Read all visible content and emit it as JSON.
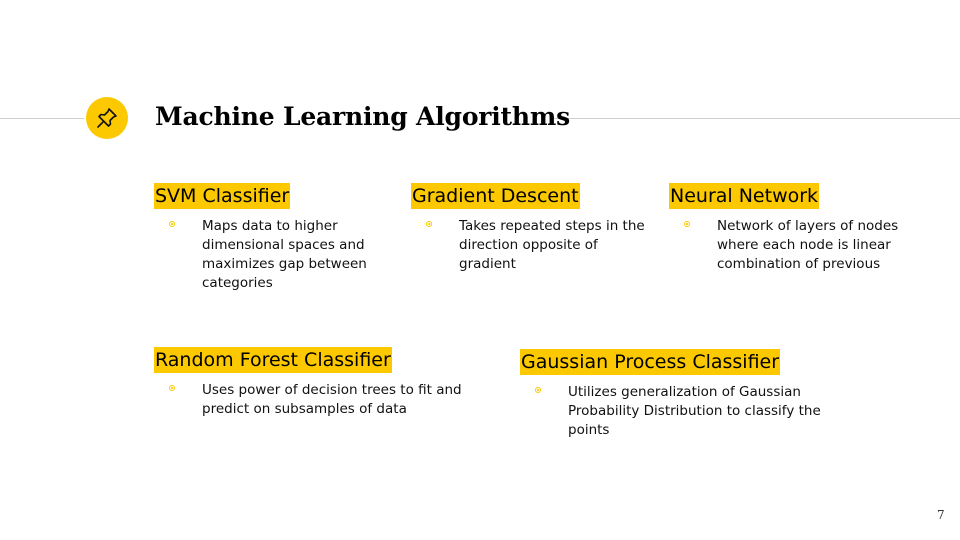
{
  "slide": {
    "title": "Machine Learning Algorithms",
    "page_number": "7",
    "accent_color": "#fcc800",
    "title_icon": "pushpin-icon"
  },
  "cards": [
    {
      "heading": "SVM Classifier",
      "text": "Maps data to higher dimensional spaces and maximizes gap between categories"
    },
    {
      "heading": "Gradient Descent",
      "text": "Takes repeated steps in the direction opposite of gradient"
    },
    {
      "heading": "Neural Network",
      "text": "Network of layers of nodes where each node is linear combination of previous"
    },
    {
      "heading": "Random Forest Classifier",
      "text": "Uses power of decision trees to fit and predict on subsamples of data"
    },
    {
      "heading": "Gaussian Process Classifier",
      "text": "Utilizes generalization of Gaussian Probability Distribution to classify the points"
    }
  ]
}
